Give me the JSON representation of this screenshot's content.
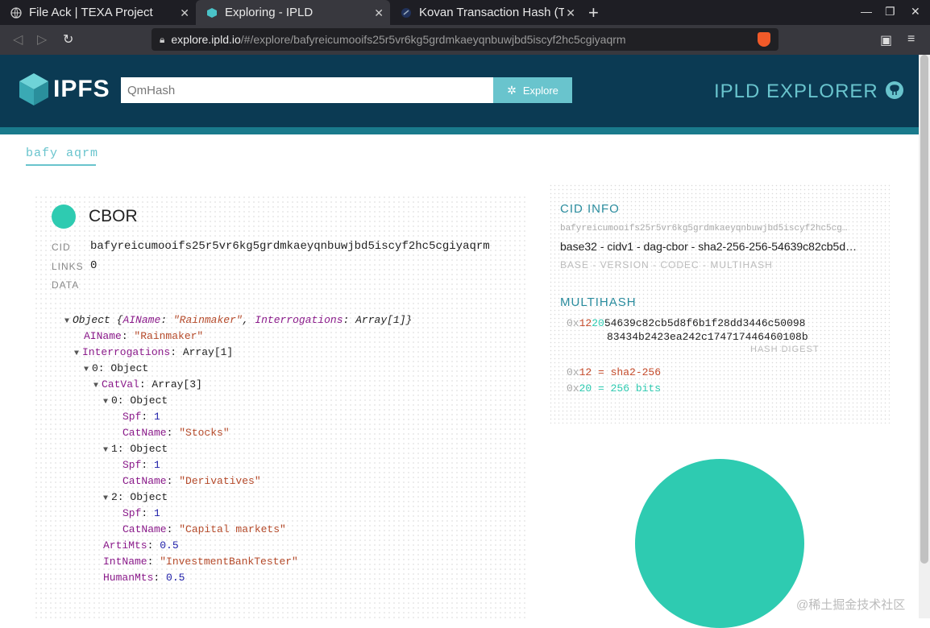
{
  "browser": {
    "tabs": [
      {
        "title": "File Ack | TEXA Project"
      },
      {
        "title": "Exploring - IPLD"
      },
      {
        "title": "Kovan Transaction Hash (T"
      }
    ],
    "url_host": "explore.ipld.io",
    "url_path": "/#/explore/bafyreicumooifs25r5vr6kg5grdmkaeyqnbuwjbd5iscyf2hc5cgiyaqrm"
  },
  "header": {
    "logo_text": "IPFS",
    "search_placeholder": "QmHash",
    "explore_label": "Explore",
    "site_title": "IPLD EXPLORER"
  },
  "breadcrumb": "bafy aqrm",
  "node": {
    "format": "CBOR",
    "cid_label": "CID",
    "cid": "bafyreicumooifs25r5vr6kg5grdmkaeyqnbuwjbd5iscyf2hc5cgiyaqrm",
    "links_label": "LINKS",
    "links": "0",
    "data_label": "DATA"
  },
  "tree": {
    "root_label": "Object",
    "root_summary_open": "{",
    "ainame_key": "AIName",
    "ainame_val": "\"Rainmaker\"",
    "interrogations_key": "Interrogations",
    "interrogations_val": "Array[1]",
    "root_summary_close": "}",
    "i0_label": "0: Object",
    "catval_key": "CatVal",
    "catval_val": "Array[3]",
    "items": [
      {
        "label": "0: Object",
        "spf": "1",
        "catname": "\"Stocks\""
      },
      {
        "label": "1: Object",
        "spf": "1",
        "catname": "\"Derivatives\""
      },
      {
        "label": "2: Object",
        "spf": "1",
        "catname": "\"Capital markets\""
      }
    ],
    "spf_key": "Spf",
    "catname_key": "CatName",
    "artimts_key": "ArtiMts",
    "artimts_val": "0.5",
    "intname_key": "IntName",
    "intname_val": "\"InvestmentBankTester\"",
    "humanmts_key": "HumanMts",
    "humanmts_val": "0.5"
  },
  "cid_info": {
    "title": "CID INFO",
    "cid_truncated": "bafyreicumooifs25r5vr6kg5grdmkaeyqnbuwjbd5iscyf2hc5cg…",
    "desc": "base32 - cidv1 - dag-cbor - sha2-256-256-54639c82cb5d…",
    "desc_sub": "BASE - VERSION - CODEC - MULTIHASH",
    "multihash_title": "MULTIHASH",
    "mh_prefix": "0x",
    "mh_fn": "12",
    "mh_len": "20",
    "mh_digest_1": "54639c82cb5d8f6b1f28dd3446c50098",
    "mh_digest_2": "83434b2423ea242c174717446460108b",
    "hash_digest_label": "HASH DIGEST",
    "fn_line_prefix": "0x",
    "fn_line_code": "12",
    "fn_line_val": " = sha2-256",
    "len_line_prefix": "0x",
    "len_line_code": "20",
    "len_line_val": " = 256 bits"
  },
  "watermark": "@稀土掘金技术社区",
  "colors": {
    "header_bg": "#0b3a53",
    "accent": "#69c4cd",
    "cbor_green": "#2ecbb1"
  }
}
